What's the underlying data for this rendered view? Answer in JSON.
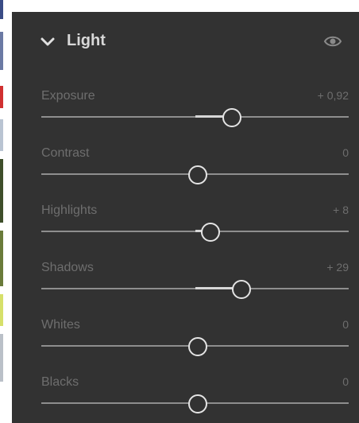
{
  "panel": {
    "title": "Light",
    "collapse_icon": "chevron-down-icon",
    "visibility_icon": "eye-icon"
  },
  "sliders": [
    {
      "label": "Exposure",
      "value": "+ 0,92",
      "position": 0.62
    },
    {
      "label": "Contrast",
      "value": "0",
      "position": 0.51
    },
    {
      "label": "Highlights",
      "value": "+ 8",
      "position": 0.55
    },
    {
      "label": "Shadows",
      "value": "+ 29",
      "position": 0.65
    },
    {
      "label": "Whites",
      "value": "0",
      "position": 0.51
    },
    {
      "label": "Blacks",
      "value": "0",
      "position": 0.51
    }
  ],
  "colors": {
    "panel_bg": "#323232",
    "title": "#d8d8d8",
    "label": "#6e6e6e",
    "track": "#8e8e8e",
    "knob": "#e4e4e4"
  }
}
